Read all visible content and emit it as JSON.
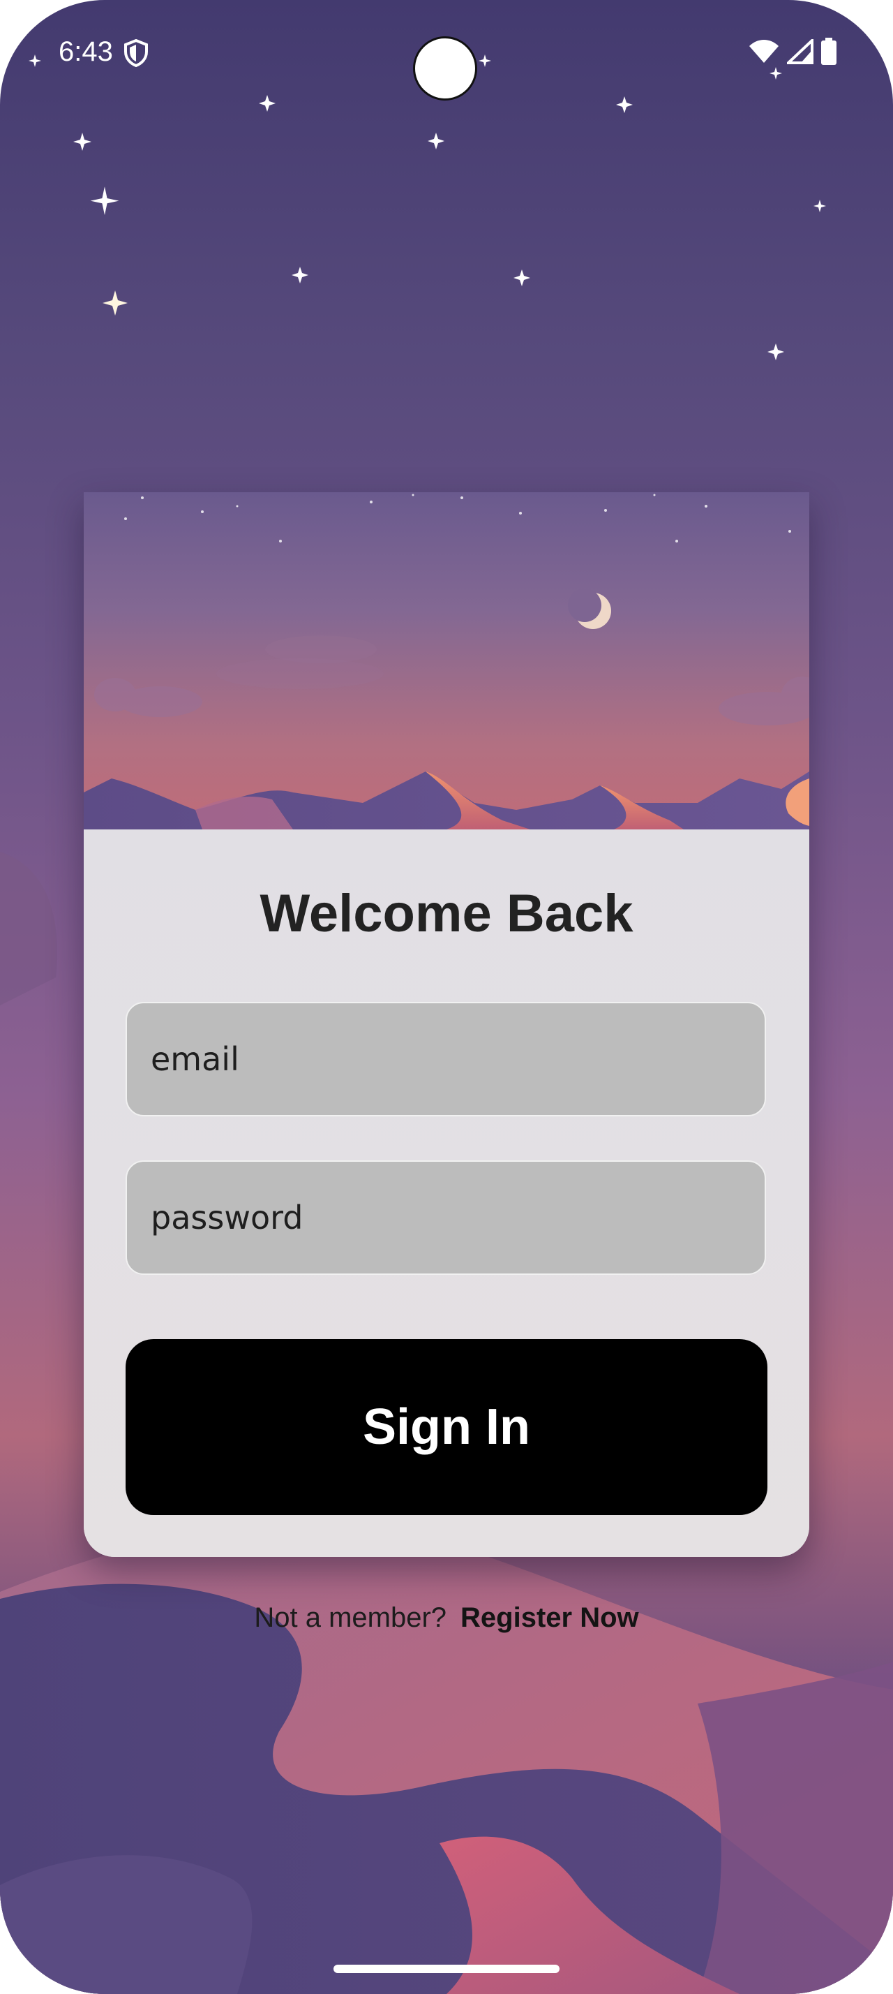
{
  "status_bar": {
    "time": "6:43",
    "icons": [
      "shield-icon",
      "wifi-icon",
      "signal-icon",
      "battery-icon"
    ]
  },
  "login_card": {
    "title": "Welcome Back",
    "email_placeholder": "email",
    "password_placeholder": "password",
    "sign_in_label": "Sign In"
  },
  "register": {
    "prompt": "Not a member?",
    "link_label": "Register Now"
  },
  "colors": {
    "button_bg": "#000000",
    "button_text": "#ffffff",
    "field_bg": "#bcbcbc",
    "card_bg": "#e2dfe3",
    "title_text": "#222222"
  }
}
